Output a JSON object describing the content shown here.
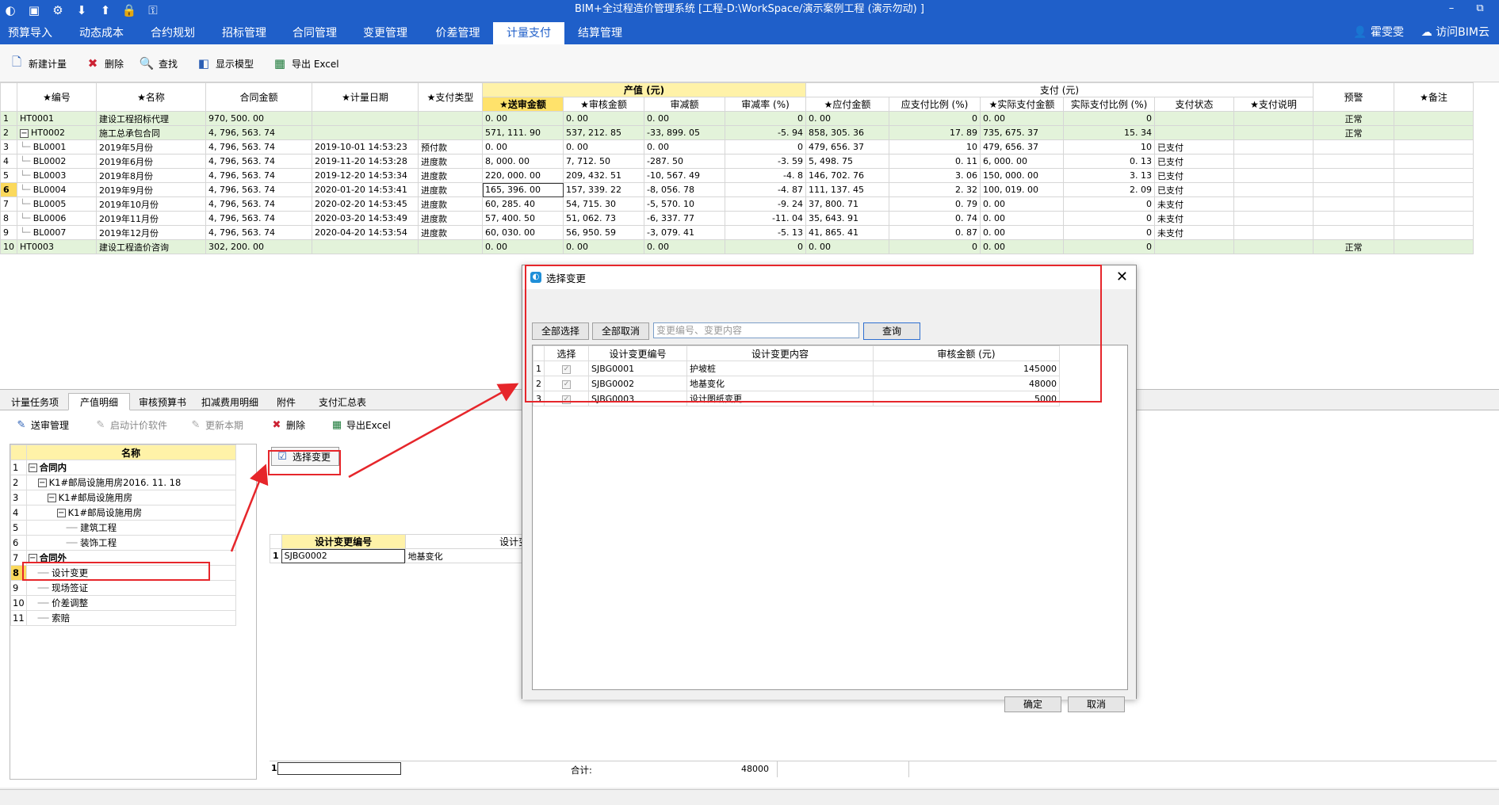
{
  "window": {
    "title": "BIM+全过程造价管理系统 [工程-D:\\WorkSpace/演示案例工程 (演示勿动) ]",
    "minimize": "–",
    "restore": "⧉"
  },
  "menu": {
    "tabs": [
      "预算导入",
      "动态成本",
      "合约规划",
      "招标管理",
      "合同管理",
      "变更管理",
      "价差管理",
      "计量支付",
      "结算管理"
    ],
    "active_index": 7,
    "user": "霍雯雯",
    "cloud": "访问BIM云"
  },
  "toolbar": {
    "new": "新建计量",
    "delete": "删除",
    "find": "查找",
    "show_model": "显示模型",
    "export": "导出 Excel"
  },
  "grid": {
    "headers": {
      "code": "★编号",
      "name": "★名称",
      "contract_amount": "合同金额",
      "date": "★计量日期",
      "pay_type": "★支付类型",
      "output_group": "产值 (元)",
      "submit": "★送审金额",
      "audit": "★审核金额",
      "reduce": "审减额",
      "reduce_rate": "审减率 (%)",
      "pay_group": "支付 (元)",
      "payable": "★应付金额",
      "payable_ratio": "应支付比例 (%)",
      "paid": "★实际支付金额",
      "paid_ratio": "实际支付比例 (%)",
      "status": "支付状态",
      "note": "★支付说明",
      "warn": "预警",
      "remark": "★备注"
    },
    "rows": [
      {
        "n": "1",
        "code": "HT0001",
        "name": "建设工程招标代理",
        "amount": "970, 500. 00",
        "date": "",
        "type": "",
        "submit": "0. 00",
        "audit": "0. 00",
        "reduce": "0. 00",
        "rate": "0",
        "payable": "0. 00",
        "pratio": "0",
        "paid": "0. 00",
        "aratio": "0",
        "status": "",
        "note": "",
        "warn": "正常",
        "remark": "",
        "grp": true,
        "exp": ""
      },
      {
        "n": "2",
        "code": "HT0002",
        "name": "施工总承包合同",
        "amount": "4, 796, 563. 74",
        "date": "",
        "type": "",
        "submit": "571, 111. 90",
        "audit": "537, 212. 85",
        "reduce": "-33, 899. 05",
        "rate": "-5. 94",
        "payable": "858, 305. 36",
        "pratio": "17. 89",
        "paid": "735, 675. 37",
        "aratio": "15. 34",
        "status": "",
        "note": "",
        "warn": "正常",
        "remark": "",
        "grp": true,
        "exp": "−"
      },
      {
        "n": "3",
        "code": "BL0001",
        "name": "2019年5月份",
        "amount": "4, 796, 563. 74",
        "date": "2019-10-01 14:53:23",
        "type": "预付款",
        "submit": "0. 00",
        "audit": "0. 00",
        "reduce": "0. 00",
        "rate": "0",
        "payable": "479, 656. 37",
        "pratio": "10",
        "paid": "479, 656. 37",
        "aratio": "10",
        "status": "已支付",
        "note": "",
        "warn": "",
        "remark": ""
      },
      {
        "n": "4",
        "code": "BL0002",
        "name": "2019年6月份",
        "amount": "4, 796, 563. 74",
        "date": "2019-11-20 14:53:28",
        "type": "进度款",
        "submit": "8, 000. 00",
        "audit": "7, 712. 50",
        "reduce": "-287. 50",
        "rate": "-3. 59",
        "payable": "5, 498. 75",
        "pratio": "0. 11",
        "paid": "6, 000. 00",
        "aratio": "0. 13",
        "status": "已支付",
        "note": "",
        "warn": "",
        "remark": ""
      },
      {
        "n": "5",
        "code": "BL0003",
        "name": "2019年8月份",
        "amount": "4, 796, 563. 74",
        "date": "2019-12-20 14:53:34",
        "type": "进度款",
        "submit": "220, 000. 00",
        "audit": "209, 432. 51",
        "reduce": "-10, 567. 49",
        "rate": "-4. 8",
        "payable": "146, 702. 76",
        "pratio": "3. 06",
        "paid": "150, 000. 00",
        "aratio": "3. 13",
        "status": "已支付",
        "note": "",
        "warn": "",
        "remark": ""
      },
      {
        "n": "6",
        "code": "BL0004",
        "name": "2019年9月份",
        "amount": "4, 796, 563. 74",
        "date": "2020-01-20 14:53:41",
        "type": "进度款",
        "submit": "165, 396. 00",
        "audit": "157, 339. 22",
        "reduce": "-8, 056. 78",
        "rate": "-4. 87",
        "payable": "111, 137. 45",
        "pratio": "2. 32",
        "paid": "100, 019. 00",
        "aratio": "2. 09",
        "status": "已支付",
        "note": "",
        "warn": "",
        "remark": "",
        "cur": true
      },
      {
        "n": "7",
        "code": "BL0005",
        "name": "2019年10月份",
        "amount": "4, 796, 563. 74",
        "date": "2020-02-20 14:53:45",
        "type": "进度款",
        "submit": "60, 285. 40",
        "audit": "54, 715. 30",
        "reduce": "-5, 570. 10",
        "rate": "-9. 24",
        "payable": "37, 800. 71",
        "pratio": "0. 79",
        "paid": "0. 00",
        "aratio": "0",
        "status": "未支付",
        "note": "",
        "warn": "",
        "remark": ""
      },
      {
        "n": "8",
        "code": "BL0006",
        "name": "2019年11月份",
        "amount": "4, 796, 563. 74",
        "date": "2020-03-20 14:53:49",
        "type": "进度款",
        "submit": "57, 400. 50",
        "audit": "51, 062. 73",
        "reduce": "-6, 337. 77",
        "rate": "-11. 04",
        "payable": "35, 643. 91",
        "pratio": "0. 74",
        "paid": "0. 00",
        "aratio": "0",
        "status": "未支付",
        "note": "",
        "warn": "",
        "remark": ""
      },
      {
        "n": "9",
        "code": "BL0007",
        "name": "2019年12月份",
        "amount": "4, 796, 563. 74",
        "date": "2020-04-20 14:53:54",
        "type": "进度款",
        "submit": "60, 030. 00",
        "audit": "56, 950. 59",
        "reduce": "-3, 079. 41",
        "rate": "-5. 13",
        "payable": "41, 865. 41",
        "pratio": "0. 87",
        "paid": "0. 00",
        "aratio": "0",
        "status": "未支付",
        "note": "",
        "warn": "",
        "remark": ""
      },
      {
        "n": "10",
        "code": "HT0003",
        "name": "建设工程造价咨询",
        "amount": "302, 200. 00",
        "date": "",
        "type": "",
        "submit": "0. 00",
        "audit": "0. 00",
        "reduce": "0. 00",
        "rate": "0",
        "payable": "0. 00",
        "pratio": "0",
        "paid": "0. 00",
        "aratio": "0",
        "status": "",
        "note": "",
        "warn": "正常",
        "remark": "",
        "grp": true,
        "exp": ""
      }
    ]
  },
  "subtabs": [
    "计量任务项",
    "产值明细",
    "审核预算书",
    "扣减费用明细",
    "附件",
    "支付汇总表"
  ],
  "subtab_active": 1,
  "subbar": {
    "review": "送审管理",
    "launch": "启动计价软件",
    "refresh": "更新本期",
    "delete": "删除",
    "export": "导出Excel"
  },
  "tree": {
    "header": "名称",
    "rows": [
      {
        "n": "1",
        "label": "合同内",
        "indent": 0,
        "exp": "−",
        "bold": true
      },
      {
        "n": "2",
        "label": "K1#邮局设施用房2016. 11. 18",
        "indent": 1,
        "exp": "−"
      },
      {
        "n": "3",
        "label": "K1#邮局设施用房",
        "indent": 2,
        "exp": "−"
      },
      {
        "n": "4",
        "label": "K1#邮局设施用房",
        "indent": 3,
        "exp": "−"
      },
      {
        "n": "5",
        "label": "建筑工程",
        "indent": 4,
        "exp": ""
      },
      {
        "n": "6",
        "label": "装饰工程",
        "indent": 4,
        "exp": ""
      },
      {
        "n": "7",
        "label": "合同外",
        "indent": 0,
        "exp": "−",
        "bold": true
      },
      {
        "n": "8",
        "label": "设计变更",
        "indent": 1,
        "exp": "",
        "cur": true
      },
      {
        "n": "9",
        "label": "现场签证",
        "indent": 1,
        "exp": ""
      },
      {
        "n": "10",
        "label": "价差调整",
        "indent": 1,
        "exp": ""
      },
      {
        "n": "11",
        "label": "索赔",
        "indent": 1,
        "exp": ""
      }
    ]
  },
  "change_pane": {
    "select_button": "选择变更",
    "headers": [
      "设计变更编号",
      "设计变更内容"
    ],
    "rows": [
      {
        "n": "1",
        "code": "SJBG0002",
        "content": "地基变化"
      }
    ],
    "footer_n": "1",
    "total_label": "合计:",
    "total_value": "48000"
  },
  "dialog": {
    "title": "选择变更",
    "select_all": "全部选择",
    "deselect_all": "全部取消",
    "search_placeholder": "变更编号、变更内容",
    "query": "查询",
    "headers": [
      "选择",
      "设计变更编号",
      "设计变更内容",
      "审核金额 (元)"
    ],
    "rows": [
      {
        "n": "1",
        "code": "SJBG0001",
        "content": "护坡桩",
        "amount": "145000"
      },
      {
        "n": "2",
        "code": "SJBG0002",
        "content": "地基变化",
        "amount": "48000"
      },
      {
        "n": "3",
        "code": "SJBG0003",
        "content": "设计图纸变更",
        "amount": "5000"
      }
    ],
    "ok": "确定",
    "cancel": "取消"
  },
  "colors": {
    "brand": "#1f5fc9",
    "group_row": "#e3f3da",
    "header_yellow": "#fff2a8",
    "annotation_red": "#e6262b"
  }
}
